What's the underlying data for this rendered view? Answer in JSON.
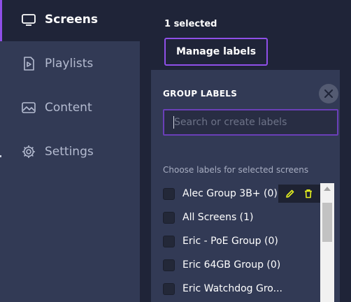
{
  "sidebar": {
    "items": [
      {
        "label": "Screens",
        "icon": "monitor-icon",
        "active": true
      },
      {
        "label": "Playlists",
        "icon": "playlist-icon",
        "active": false
      },
      {
        "label": "Content",
        "icon": "image-icon",
        "active": false
      },
      {
        "label": "Settings",
        "icon": "gear-icon",
        "active": false
      }
    ]
  },
  "main": {
    "selected_count": "1 selected",
    "manage_labels_button": "Manage labels"
  },
  "popup": {
    "title": "GROUP LABELS",
    "search_placeholder": "Search or create labels",
    "choose_text": "Choose labels for selected screens",
    "labels": [
      {
        "name": "Alec Group 3B+ (0)",
        "checked": false,
        "hovered": true
      },
      {
        "name": "All Screens (1)",
        "checked": false
      },
      {
        "name": "Eric - PoE Group (0)",
        "checked": false
      },
      {
        "name": "Eric 64GB Group (0)",
        "checked": false
      },
      {
        "name": "Eric Watchdog Gro...",
        "checked": false
      }
    ],
    "row_actions": {
      "edit_icon": "pencil-icon",
      "delete_icon": "trash-icon"
    }
  },
  "colors": {
    "accent": "#8f4fe8",
    "sidebar_bg": "#323a55",
    "main_bg": "#1f2438",
    "popup_bg": "#323a55",
    "action_highlight": "#e8f31f"
  }
}
